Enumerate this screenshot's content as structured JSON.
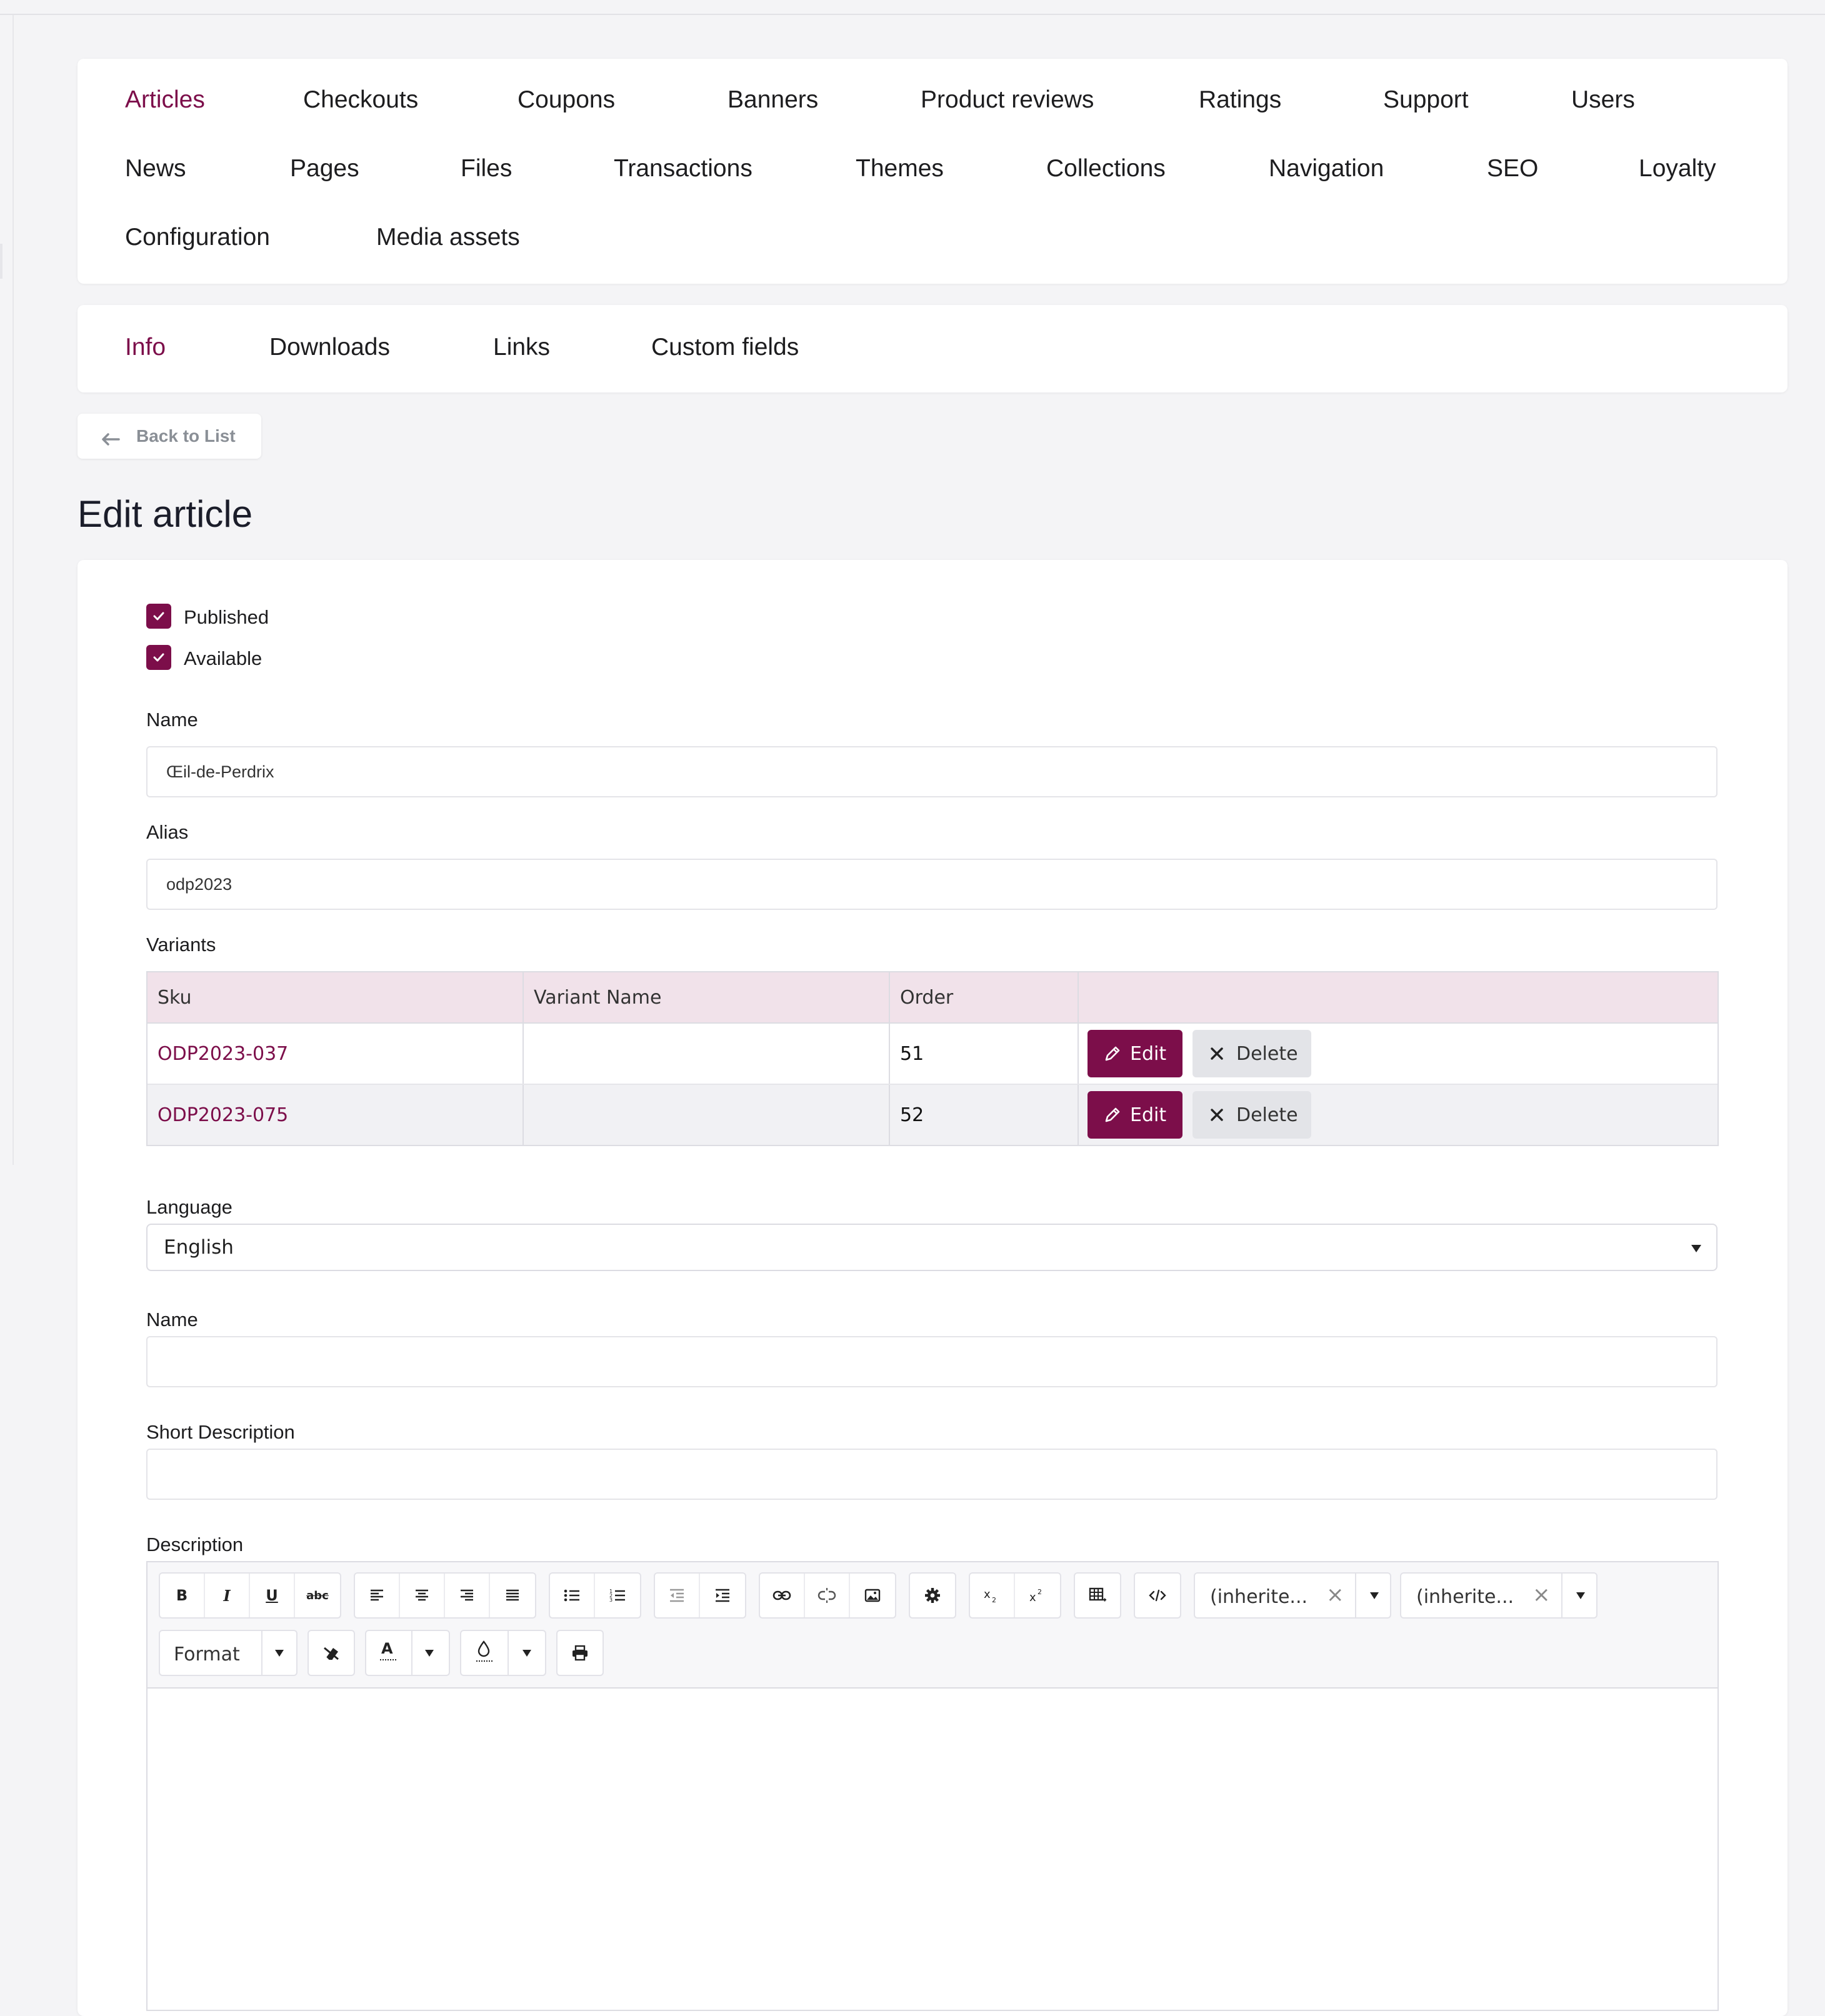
{
  "main_nav": {
    "items": [
      {
        "label": "Articles",
        "active": true
      },
      {
        "label": "Checkouts"
      },
      {
        "label": "Coupons"
      },
      {
        "label": "Banners"
      },
      {
        "label": "Product reviews"
      },
      {
        "label": "Ratings"
      },
      {
        "label": "Support"
      },
      {
        "label": "Users"
      },
      {
        "label": "News"
      },
      {
        "label": "Pages"
      },
      {
        "label": "Files"
      },
      {
        "label": "Transactions"
      },
      {
        "label": "Themes"
      },
      {
        "label": "Collections"
      },
      {
        "label": "Navigation"
      },
      {
        "label": "SEO"
      },
      {
        "label": "Loyalty"
      },
      {
        "label": "Configuration"
      },
      {
        "label": "Media assets"
      }
    ]
  },
  "sub_nav": {
    "items": [
      {
        "label": "Info",
        "active": true
      },
      {
        "label": "Downloads"
      },
      {
        "label": "Links"
      },
      {
        "label": "Custom fields"
      }
    ]
  },
  "back_button": {
    "label": "Back to List",
    "icon": "arrow-left-icon"
  },
  "page_title": "Edit article",
  "form": {
    "published": {
      "label": "Published",
      "checked": true
    },
    "available": {
      "label": "Available",
      "checked": true
    },
    "name": {
      "label": "Name",
      "value": "Œil-de-Perdrix"
    },
    "alias": {
      "label": "Alias",
      "value": "odp2023"
    },
    "variants": {
      "label": "Variants",
      "columns": [
        "Sku",
        "Variant Name",
        "Order",
        ""
      ],
      "rows": [
        {
          "sku": "ODP2023-037",
          "variant_name": "",
          "order": "51"
        },
        {
          "sku": "ODP2023-075",
          "variant_name": "",
          "order": "52"
        }
      ],
      "edit_label": "Edit",
      "delete_label": "Delete"
    },
    "language": {
      "label": "Language",
      "value": "English"
    },
    "lang_name": {
      "label": "Name",
      "value": ""
    },
    "short_description": {
      "label": "Short Description",
      "value": ""
    },
    "description": {
      "label": "Description",
      "font_family_value": "(inherite...",
      "font_size_value": "(inherite...",
      "format_label": "Format"
    }
  },
  "colors": {
    "accent": "#7c0e4a",
    "accent_tint": "#f1e2ea",
    "background": "#f4f4f6"
  }
}
